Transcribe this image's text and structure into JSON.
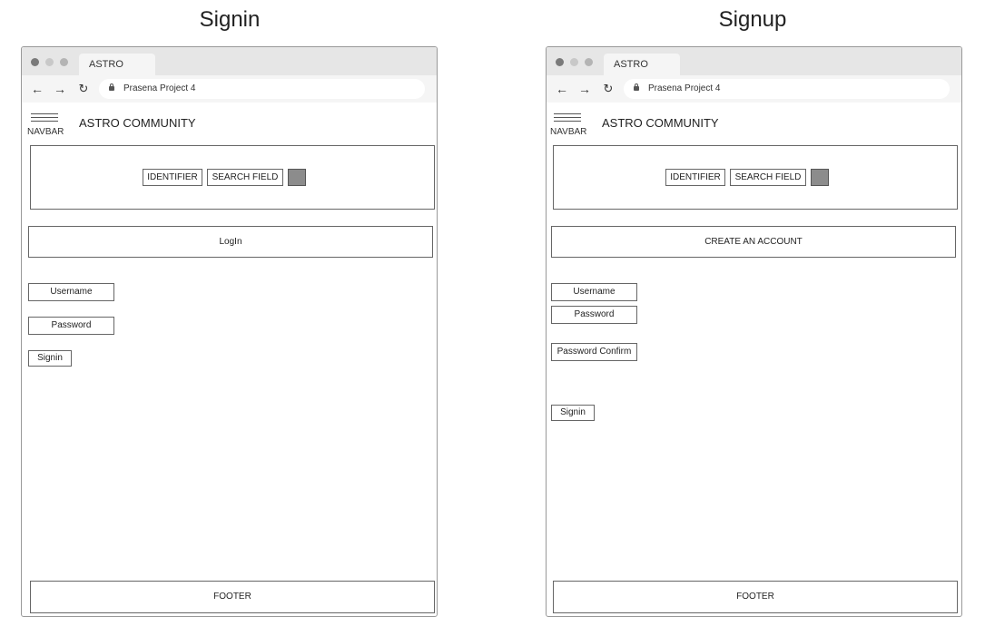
{
  "frames": [
    {
      "title": "Signin",
      "tab_label": "ASTRO",
      "url": "Prasena Project 4",
      "navbar_label": "NAVBAR",
      "brand": "ASTRO COMMUNITY",
      "identifier_label": "IDENTIFIER",
      "search_label": "SEARCH FIELD",
      "banner_label": "LogIn",
      "fields": [
        "Username",
        "Password"
      ],
      "submit_label": "Signin",
      "footer_label": "FOOTER"
    },
    {
      "title": "Signup",
      "tab_label": "ASTRO",
      "url": "Prasena Project 4",
      "navbar_label": "NAVBAR",
      "brand": "ASTRO COMMUNITY",
      "identifier_label": "IDENTIFIER",
      "search_label": "SEARCH FIELD",
      "banner_label": "CREATE AN ACCOUNT",
      "fields": [
        "Username",
        "Password",
        "Password Confirm"
      ],
      "submit_label": "Signin",
      "footer_label": "FOOTER"
    }
  ],
  "icons": {
    "back": "arrow-left-icon",
    "forward": "arrow-right-icon",
    "reload": "reload-icon",
    "lock": "lock-icon",
    "menu": "hamburger-menu-icon"
  },
  "colors": {
    "border": "#666666",
    "chrome": "#e6e6e6",
    "search_button": "#8c8c8c"
  }
}
